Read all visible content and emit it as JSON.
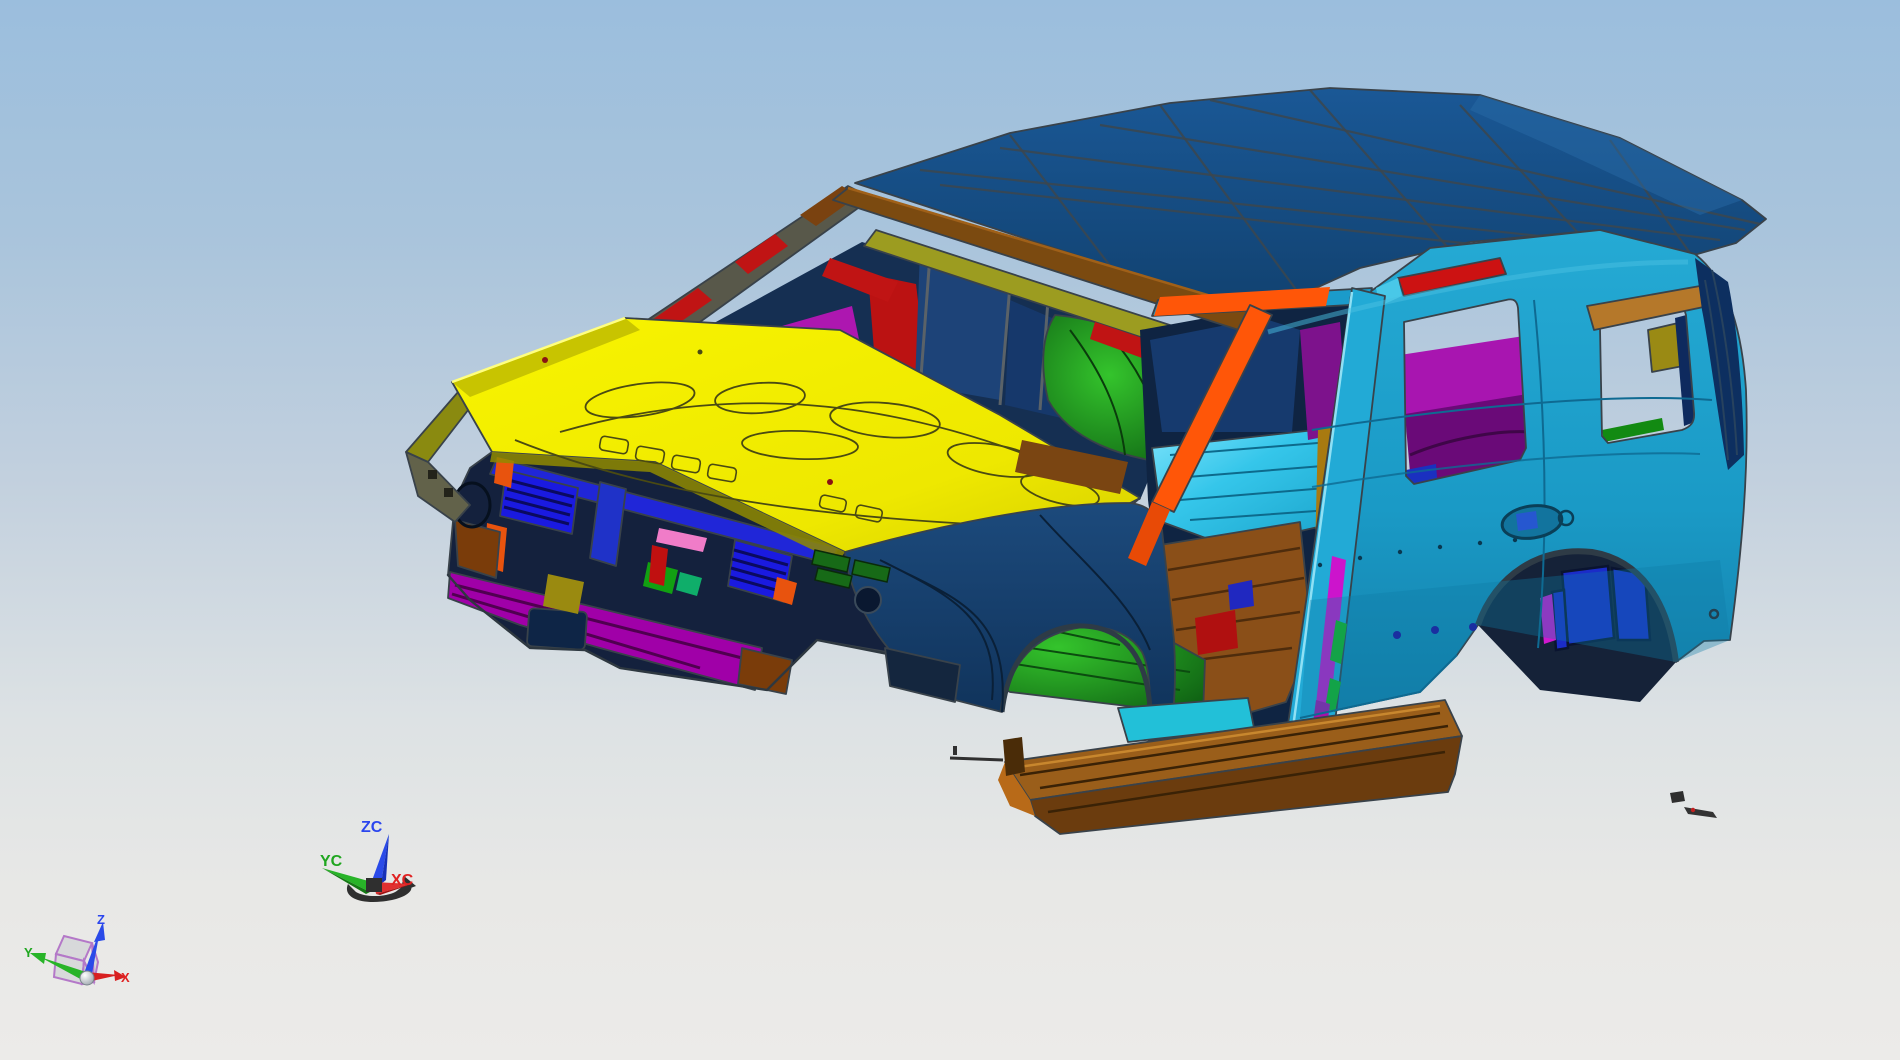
{
  "viewport": {
    "type": "cad-3d-viewport",
    "background": {
      "top": "#9bbedd",
      "middle": "#c2d0de",
      "bottom": "#ecebe9"
    }
  },
  "wcs_triad": {
    "labels": {
      "z": "ZC",
      "y": "YC",
      "x": "XC"
    },
    "colors": {
      "z": "#2b46ee",
      "y": "#1fa61f",
      "x": "#e02222",
      "handle": "#2f2f2f"
    }
  },
  "datum_csys": {
    "labels": {
      "z": "Z",
      "y": "Y",
      "x": "X"
    },
    "colors": {
      "z": "#2b46ee",
      "y": "#1fa61f",
      "x": "#e02222",
      "cube_edge": "#b478c8",
      "origin_ball": "#f4f4f4"
    }
  },
  "model": {
    "description": "automotive body-in-white assembly, front three-quarter view",
    "parts": [
      {
        "name": "hood-panel",
        "color": "#f2ee00"
      },
      {
        "name": "roof-panel",
        "color": "#164f8b"
      },
      {
        "name": "body-side-outer",
        "color": "#1ea2cd"
      },
      {
        "name": "front-fender",
        "color": "#17416f"
      },
      {
        "name": "windshield-header-rail",
        "color": "#7b4a10"
      },
      {
        "name": "header-reinforcement",
        "color": "#9c9c20"
      },
      {
        "name": "a-pillar-frame",
        "color": "#ff5608"
      },
      {
        "name": "header-bracket",
        "color": "#c81414"
      },
      {
        "name": "cowl-panel",
        "color": "#a312a8"
      },
      {
        "name": "radiator-support",
        "color": "#1a1ae0"
      },
      {
        "name": "bumper-crossmember",
        "color": "#a000a8"
      },
      {
        "name": "rocker-step-assembly",
        "color": "#9a5e1a"
      },
      {
        "name": "front-floor-pan",
        "color": "#27c214"
      },
      {
        "name": "interior-floor",
        "color": "#35c6ea"
      },
      {
        "name": "rear-floor-pan",
        "color": "#8a4f18"
      },
      {
        "name": "cargo-side-trim",
        "color": "#7d0c90"
      },
      {
        "name": "rear-wheelhouse",
        "color": "#1b2cc8"
      },
      {
        "name": "b-pillar-reinforcement",
        "color": "#cc14cc"
      },
      {
        "name": "d-pillar-inner",
        "color": "#0d2f60"
      },
      {
        "name": "loose-small-parts",
        "color": "#303030"
      }
    ]
  }
}
